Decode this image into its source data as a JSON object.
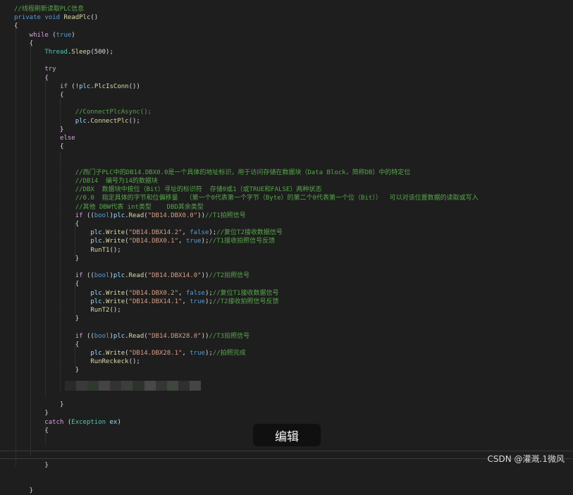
{
  "colors": {
    "background": "#1e1e1e",
    "keyword": "#569cd6",
    "control": "#d8a0df",
    "type": "#4ec9b0",
    "method": "#dcdcaa",
    "string": "#d69d85",
    "comment": "#57a64a",
    "variable": "#9cdcfe",
    "plain": "#dcdcdc"
  },
  "code": [
    [
      {
        "t": "//线程刷新读取PLC信息",
        "k": "comment"
      }
    ],
    [
      {
        "t": "private ",
        "k": "keyword"
      },
      {
        "t": "void ",
        "k": "keyword"
      },
      {
        "t": "ReadPlc",
        "k": "method"
      },
      {
        "t": "()",
        "k": "plain"
      }
    ],
    [
      {
        "t": "{",
        "k": "plain"
      }
    ],
    [
      {
        "t": "    while ",
        "k": "control"
      },
      {
        "t": "(",
        "k": "plain"
      },
      {
        "t": "true",
        "k": "keyword"
      },
      {
        "t": ")",
        "k": "plain"
      }
    ],
    [
      {
        "t": "    {",
        "k": "plain"
      }
    ],
    [
      {
        "t": "        Thread",
        "k": "type"
      },
      {
        "t": ".",
        "k": "plain"
      },
      {
        "t": "Sleep",
        "k": "method"
      },
      {
        "t": "(500);",
        "k": "plain"
      }
    ],
    [],
    [
      {
        "t": "        try",
        "k": "control"
      }
    ],
    [
      {
        "t": "        {",
        "k": "plain"
      }
    ],
    [
      {
        "t": "            if ",
        "k": "control"
      },
      {
        "t": "(!",
        "k": "plain"
      },
      {
        "t": "plc",
        "k": "variable"
      },
      {
        "t": ".",
        "k": "plain"
      },
      {
        "t": "PlcIsConn",
        "k": "method"
      },
      {
        "t": "())",
        "k": "plain"
      }
    ],
    [
      {
        "t": "            {",
        "k": "plain"
      }
    ],
    [],
    [
      {
        "t": "                //ConnectPlcAsync();",
        "k": "comment"
      }
    ],
    [
      {
        "t": "                plc",
        "k": "variable"
      },
      {
        "t": ".",
        "k": "plain"
      },
      {
        "t": "ConnectPlc",
        "k": "method"
      },
      {
        "t": "();",
        "k": "plain"
      }
    ],
    [
      {
        "t": "            }",
        "k": "plain"
      }
    ],
    [
      {
        "t": "            else",
        "k": "control"
      }
    ],
    [
      {
        "t": "            {",
        "k": "plain"
      }
    ],
    [],
    [],
    [
      {
        "t": "                //西门子PLC中的DB14.DBX0.0是一个具体的地址标识，用于访问存储在数据块（Data Block，简称DB）中的特定位",
        "k": "comment"
      }
    ],
    [
      {
        "t": "                //DB14  编号为14的数据块",
        "k": "comment"
      }
    ],
    [
      {
        "t": "                //DBX  数据块中按位（Bit）寻址的标识符  存储0或1（或TRUE和FALSE）两种状态",
        "k": "comment"
      }
    ],
    [
      {
        "t": "                //0.0  指定具体的字节和位偏移量  （第一个0代表第一个字节（Byte）的第二个0代表第一个位（Bit））  可以对该位置数据的读取或写入",
        "k": "comment"
      }
    ],
    [
      {
        "t": "                //其他 DBW代表 int类型    DBD其余类型",
        "k": "comment"
      }
    ],
    [
      {
        "t": "                if ",
        "k": "control"
      },
      {
        "t": "((",
        "k": "plain"
      },
      {
        "t": "bool",
        "k": "keyword"
      },
      {
        "t": ")",
        "k": "plain"
      },
      {
        "t": "plc",
        "k": "variable"
      },
      {
        "t": ".",
        "k": "plain"
      },
      {
        "t": "Read",
        "k": "method"
      },
      {
        "t": "(",
        "k": "plain"
      },
      {
        "t": "\"DB14.DBX0.0\"",
        "k": "string"
      },
      {
        "t": "))",
        "k": "plain"
      },
      {
        "t": "//T1拍照信号",
        "k": "comment"
      }
    ],
    [
      {
        "t": "                {",
        "k": "plain"
      }
    ],
    [
      {
        "t": "                    plc",
        "k": "variable"
      },
      {
        "t": ".",
        "k": "plain"
      },
      {
        "t": "Write",
        "k": "method"
      },
      {
        "t": "(",
        "k": "plain"
      },
      {
        "t": "\"DB14.DBX14.2\"",
        "k": "string"
      },
      {
        "t": ", ",
        "k": "plain"
      },
      {
        "t": "false",
        "k": "keyword"
      },
      {
        "t": ");",
        "k": "plain"
      },
      {
        "t": "//复位T2接收数据信号",
        "k": "comment"
      }
    ],
    [
      {
        "t": "                    plc",
        "k": "variable"
      },
      {
        "t": ".",
        "k": "plain"
      },
      {
        "t": "Write",
        "k": "method"
      },
      {
        "t": "(",
        "k": "plain"
      },
      {
        "t": "\"DB14.DBX0.1\"",
        "k": "string"
      },
      {
        "t": ", ",
        "k": "plain"
      },
      {
        "t": "true",
        "k": "keyword"
      },
      {
        "t": ");",
        "k": "plain"
      },
      {
        "t": "//T1接收拍照信号反馈",
        "k": "comment"
      }
    ],
    [
      {
        "t": "                    RunT1",
        "k": "method"
      },
      {
        "t": "();",
        "k": "plain"
      }
    ],
    [
      {
        "t": "                }",
        "k": "plain"
      }
    ],
    [],
    [
      {
        "t": "                if ",
        "k": "control"
      },
      {
        "t": "((",
        "k": "plain"
      },
      {
        "t": "bool",
        "k": "keyword"
      },
      {
        "t": ")",
        "k": "plain"
      },
      {
        "t": "plc",
        "k": "variable"
      },
      {
        "t": ".",
        "k": "plain"
      },
      {
        "t": "Read",
        "k": "method"
      },
      {
        "t": "(",
        "k": "plain"
      },
      {
        "t": "\"DB14.DBX14.0\"",
        "k": "string"
      },
      {
        "t": "))",
        "k": "plain"
      },
      {
        "t": "//T2拍照信号",
        "k": "comment"
      }
    ],
    [
      {
        "t": "                {",
        "k": "plain"
      }
    ],
    [
      {
        "t": "                    plc",
        "k": "variable"
      },
      {
        "t": ".",
        "k": "plain"
      },
      {
        "t": "Write",
        "k": "method"
      },
      {
        "t": "(",
        "k": "plain"
      },
      {
        "t": "\"DB14.DBX0.2\"",
        "k": "string"
      },
      {
        "t": ", ",
        "k": "plain"
      },
      {
        "t": "false",
        "k": "keyword"
      },
      {
        "t": ");",
        "k": "plain"
      },
      {
        "t": "//复位T1接收数据信号",
        "k": "comment"
      }
    ],
    [
      {
        "t": "                    plc",
        "k": "variable"
      },
      {
        "t": ".",
        "k": "plain"
      },
      {
        "t": "Write",
        "k": "method"
      },
      {
        "t": "(",
        "k": "plain"
      },
      {
        "t": "\"DB14.DBX14.1\"",
        "k": "string"
      },
      {
        "t": ", ",
        "k": "plain"
      },
      {
        "t": "true",
        "k": "keyword"
      },
      {
        "t": ");",
        "k": "plain"
      },
      {
        "t": "//T2接收拍照信号反馈",
        "k": "comment"
      }
    ],
    [
      {
        "t": "                    RunT2",
        "k": "method"
      },
      {
        "t": "();",
        "k": "plain"
      }
    ],
    [
      {
        "t": "                }",
        "k": "plain"
      }
    ],
    [],
    [
      {
        "t": "                if ",
        "k": "control"
      },
      {
        "t": "((",
        "k": "plain"
      },
      {
        "t": "bool",
        "k": "keyword"
      },
      {
        "t": ")",
        "k": "plain"
      },
      {
        "t": "plc",
        "k": "variable"
      },
      {
        "t": ".",
        "k": "plain"
      },
      {
        "t": "Read",
        "k": "method"
      },
      {
        "t": "(",
        "k": "plain"
      },
      {
        "t": "\"DB14.DBX28.0\"",
        "k": "string"
      },
      {
        "t": "))",
        "k": "plain"
      },
      {
        "t": "//T3拍照信号",
        "k": "comment"
      }
    ],
    [
      {
        "t": "                {",
        "k": "plain"
      }
    ],
    [
      {
        "t": "                    plc",
        "k": "variable"
      },
      {
        "t": ".",
        "k": "plain"
      },
      {
        "t": "Write",
        "k": "method"
      },
      {
        "t": "(",
        "k": "plain"
      },
      {
        "t": "\"DB14.DBX28.1\"",
        "k": "string"
      },
      {
        "t": ", ",
        "k": "plain"
      },
      {
        "t": "true",
        "k": "keyword"
      },
      {
        "t": ");",
        "k": "plain"
      },
      {
        "t": "//拍照完成",
        "k": "comment"
      }
    ],
    [
      {
        "t": "                    RunReckeck",
        "k": "method"
      },
      {
        "t": "();",
        "k": "plain"
      }
    ],
    [
      {
        "t": "                }",
        "k": "plain"
      }
    ],
    [],
    [],
    [],
    [
      {
        "t": "            }",
        "k": "plain"
      }
    ],
    [
      {
        "t": "        }",
        "k": "plain"
      }
    ],
    [
      {
        "t": "        catch ",
        "k": "control"
      },
      {
        "t": "(",
        "k": "plain"
      },
      {
        "t": "Exception ",
        "k": "type"
      },
      {
        "t": "ex",
        "k": "variable"
      },
      {
        "t": ")",
        "k": "plain"
      }
    ],
    [
      {
        "t": "        {",
        "k": "plain"
      }
    ],
    [],
    [],
    [],
    [
      {
        "t": "        }",
        "k": "plain"
      }
    ],
    [],
    [],
    [
      {
        "t": "    }",
        "k": "plain"
      }
    ]
  ],
  "overlay": {
    "edit_label": "编辑"
  },
  "watermark": "CSDN @灌溉.1微风"
}
